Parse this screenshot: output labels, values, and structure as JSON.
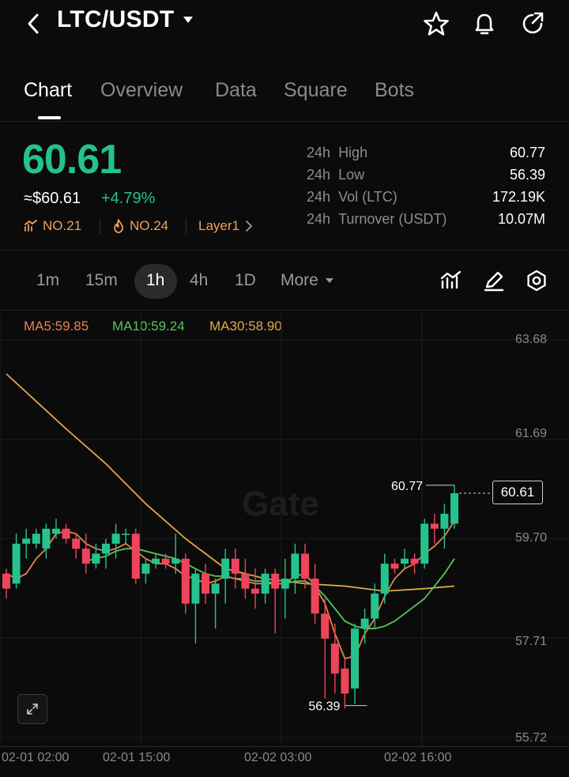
{
  "header": {
    "pair": "LTC/USDT",
    "back_icon": "chevron-left-icon",
    "dropdown_icon": "caret-down-icon",
    "actions": [
      "star-icon",
      "bell-icon",
      "share-icon"
    ]
  },
  "tabs": [
    {
      "label": "Chart",
      "active": true
    },
    {
      "label": "Overview",
      "active": false
    },
    {
      "label": "Data",
      "active": false
    },
    {
      "label": "Square",
      "active": false
    },
    {
      "label": "Bots",
      "active": false
    }
  ],
  "ticker": {
    "price": "60.61",
    "approx": "≈$60.61",
    "change": "+4.79%",
    "tags": [
      "NO.21",
      "NO.24",
      "Layer1"
    ],
    "stats": [
      {
        "period": "24h",
        "label": "High",
        "value": "60.77"
      },
      {
        "period": "24h",
        "label": "Low",
        "value": "56.39"
      },
      {
        "period": "24h",
        "label": "Vol (LTC)",
        "value": "172.19K"
      },
      {
        "period": "24h",
        "label": "Turnover (USDT)",
        "value": "10.07M"
      }
    ]
  },
  "intervals": [
    {
      "label": "1m",
      "active": false
    },
    {
      "label": "15m",
      "active": false
    },
    {
      "label": "1h",
      "active": true
    },
    {
      "label": "4h",
      "active": false
    },
    {
      "label": "1D",
      "active": false
    },
    {
      "label": "More",
      "active": false
    }
  ],
  "toolbar_icons": [
    "indicator-icon",
    "draw-icon",
    "settings-icon"
  ],
  "ma_labels": [
    {
      "text": "MA5:59.85",
      "color": "#e8834f"
    },
    {
      "text": "MA10:59.24",
      "color": "#56c65a"
    },
    {
      "text": "MA30:58.90",
      "color": "#e2a84a"
    }
  ],
  "colors": {
    "up": "#25c28e",
    "down": "#f0445a",
    "accent": "#24c28c"
  },
  "watermark": "Gate",
  "chart_data": {
    "type": "candlestick",
    "y_ticks": [
      "63.68",
      "61.69",
      "59.70",
      "57.71",
      "55.72"
    ],
    "ylim": [
      55.72,
      63.68
    ],
    "x_ticks": [
      "02-01 02:00",
      "02-01 15:00",
      "02-02 03:00",
      "02-02 16:00"
    ],
    "high_marker": "60.77",
    "low_marker": "56.39",
    "current_price_label": "60.61",
    "candles": [
      [
        59.0,
        59.1,
        58.5,
        58.7
      ],
      [
        58.8,
        59.8,
        58.7,
        59.6
      ],
      [
        59.6,
        59.9,
        59.3,
        59.7
      ],
      [
        59.6,
        59.9,
        59.5,
        59.8
      ],
      [
        59.5,
        60.0,
        59.3,
        59.9
      ],
      [
        59.8,
        60.1,
        59.7,
        59.9
      ],
      [
        59.9,
        60.0,
        59.6,
        59.7
      ],
      [
        59.7,
        59.8,
        59.3,
        59.5
      ],
      [
        59.5,
        59.8,
        59.0,
        59.2
      ],
      [
        59.2,
        59.6,
        59.1,
        59.4
      ],
      [
        59.4,
        59.7,
        59.1,
        59.6
      ],
      [
        59.6,
        60.0,
        59.3,
        59.8
      ],
      [
        59.8,
        59.9,
        59.6,
        59.8
      ],
      [
        59.8,
        59.9,
        58.8,
        58.9
      ],
      [
        59.0,
        59.3,
        58.8,
        59.2
      ],
      [
        59.2,
        59.4,
        59.1,
        59.3
      ],
      [
        59.3,
        59.4,
        59.1,
        59.2
      ],
      [
        59.2,
        59.8,
        59.0,
        59.3
      ],
      [
        59.3,
        59.4,
        58.2,
        58.4
      ],
      [
        58.4,
        59.1,
        57.6,
        59.0
      ],
      [
        59.0,
        59.2,
        58.4,
        58.6
      ],
      [
        58.6,
        58.9,
        57.9,
        58.8
      ],
      [
        58.9,
        59.5,
        58.4,
        59.3
      ],
      [
        59.3,
        59.5,
        58.7,
        59.0
      ],
      [
        59.0,
        59.3,
        58.5,
        58.7
      ],
      [
        58.7,
        59.1,
        58.3,
        58.6
      ],
      [
        58.6,
        59.1,
        58.4,
        59.0
      ],
      [
        59.0,
        59.1,
        57.8,
        58.7
      ],
      [
        58.7,
        59.3,
        58.1,
        58.9
      ],
      [
        58.9,
        59.6,
        58.6,
        59.4
      ],
      [
        59.4,
        59.6,
        58.7,
        58.9
      ],
      [
        58.9,
        59.2,
        58.0,
        58.2
      ],
      [
        58.2,
        58.5,
        56.5,
        57.7
      ],
      [
        57.6,
        58.0,
        56.6,
        57.0
      ],
      [
        57.1,
        57.3,
        56.3,
        56.6
      ],
      [
        56.7,
        58.0,
        56.39,
        57.9
      ],
      [
        57.9,
        58.3,
        57.6,
        58.1
      ],
      [
        58.1,
        58.8,
        57.9,
        58.6
      ],
      [
        58.6,
        59.4,
        58.4,
        59.2
      ],
      [
        59.2,
        59.3,
        59.0,
        59.1
      ],
      [
        59.2,
        59.5,
        59.1,
        59.3
      ],
      [
        59.3,
        59.4,
        59.0,
        59.2
      ],
      [
        59.2,
        60.1,
        59.1,
        60.0
      ],
      [
        60.0,
        60.2,
        59.6,
        59.9
      ],
      [
        59.9,
        60.4,
        59.5,
        60.2
      ],
      [
        60.0,
        60.77,
        59.9,
        60.61
      ]
    ],
    "ma5": [
      59.0,
      58.9,
      59.0,
      59.3,
      59.5,
      59.8,
      59.85,
      59.8,
      59.6,
      59.5,
      59.45,
      59.5,
      59.6,
      59.45,
      59.3,
      59.2,
      59.2,
      59.1,
      58.95,
      58.9,
      58.8,
      58.85,
      58.95,
      58.9,
      58.85,
      58.8,
      58.8,
      58.8,
      58.8,
      58.95,
      59.0,
      58.75,
      58.4,
      57.8,
      57.3,
      57.35,
      57.8,
      58.1,
      58.55,
      58.9,
      59.1,
      59.2,
      59.4,
      59.55,
      59.75,
      60.05
    ],
    "ma10": [
      null,
      null,
      null,
      null,
      null,
      null,
      null,
      null,
      59.25,
      59.3,
      59.35,
      59.45,
      59.5,
      59.5,
      59.45,
      59.4,
      59.35,
      59.3,
      59.2,
      59.1,
      59.0,
      58.95,
      58.95,
      58.9,
      58.9,
      58.85,
      58.85,
      58.8,
      58.8,
      58.85,
      58.85,
      58.75,
      58.55,
      58.3,
      58.05,
      57.95,
      57.9,
      57.9,
      57.95,
      58.05,
      58.2,
      58.35,
      58.5,
      58.75,
      59.0,
      59.3
    ],
    "ma30_line": [
      [
        0,
        63.0
      ],
      [
        6,
        61.9
      ],
      [
        10,
        61.2
      ],
      [
        14,
        60.4
      ],
      [
        18,
        59.7
      ],
      [
        22,
        59.1
      ],
      [
        26,
        58.9
      ],
      [
        30,
        58.8
      ],
      [
        34,
        58.75
      ],
      [
        38,
        58.65
      ],
      [
        42,
        58.7
      ],
      [
        45,
        58.75
      ]
    ]
  }
}
